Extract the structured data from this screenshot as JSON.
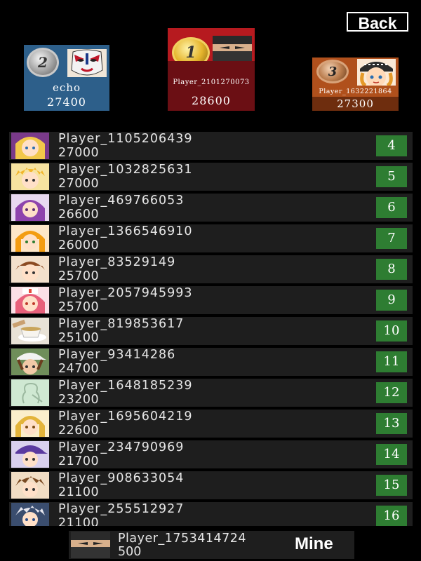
{
  "header": {
    "back_label": "Back"
  },
  "podium": {
    "first": {
      "rank": "1",
      "name": "Player_2101270073",
      "score": "28600",
      "avatar_icon": "ninja-avatar-icon",
      "color": "#b61a1f"
    },
    "second": {
      "rank": "2",
      "name": "echo",
      "score": "27400",
      "avatar_icon": "opera-mask-avatar-icon",
      "color": "#2d5f8a"
    },
    "third": {
      "rank": "3",
      "name": "Player_1632221864",
      "score": "27300",
      "avatar_icon": "girl-beret-avatar-icon",
      "color": "#b0501c"
    }
  },
  "rows": [
    {
      "name": "Player_1105206439",
      "score": "27000",
      "rank": "4",
      "avatar_icon": "blonde-girl-avatar-icon"
    },
    {
      "name": "Player_1032825631",
      "score": "27000",
      "rank": "5",
      "avatar_icon": "yellow-hair-boy-avatar-icon"
    },
    {
      "name": "Player_469766053",
      "score": "26600",
      "rank": "6",
      "avatar_icon": "purple-hair-girl-avatar-icon"
    },
    {
      "name": "Player_1366546910",
      "score": "26000",
      "rank": "7",
      "avatar_icon": "orange-hair-girl-avatar-icon"
    },
    {
      "name": "Player_83529149",
      "score": "25700",
      "rank": "8",
      "avatar_icon": "brown-hair-boy-avatar-icon"
    },
    {
      "name": "Player_2057945993",
      "score": "25700",
      "rank": "9",
      "avatar_icon": "nurse-girl-avatar-icon"
    },
    {
      "name": "Player_819853617",
      "score": "25100",
      "rank": "10",
      "avatar_icon": "tea-cup-avatar-icon"
    },
    {
      "name": "Player_93414286",
      "score": "24700",
      "rank": "11",
      "avatar_icon": "cap-boy-avatar-icon"
    },
    {
      "name": "Player_1648185239",
      "score": "23200",
      "rank": "12",
      "avatar_icon": "default-silhouette-avatar-icon"
    },
    {
      "name": "Player_1695604219",
      "score": "22600",
      "rank": "13",
      "avatar_icon": "blonde-bob-girl-avatar-icon"
    },
    {
      "name": "Player_234790969",
      "score": "21700",
      "rank": "14",
      "avatar_icon": "purple-cap-boy-avatar-icon"
    },
    {
      "name": "Player_908633054",
      "score": "21100",
      "rank": "15",
      "avatar_icon": "brown-boy-avatar-icon"
    },
    {
      "name": "Player_255512927",
      "score": "21100",
      "rank": "16",
      "avatar_icon": "silver-hair-warrior-avatar-icon"
    }
  ],
  "mine": {
    "name": "Player_1753414724",
    "score": "500",
    "label": "Mine",
    "avatar_icon": "ninja-avatar-icon"
  },
  "colors": {
    "rank_badge": "#2e7d32",
    "row_bg": "#1e1e1e",
    "background": "#000000"
  }
}
